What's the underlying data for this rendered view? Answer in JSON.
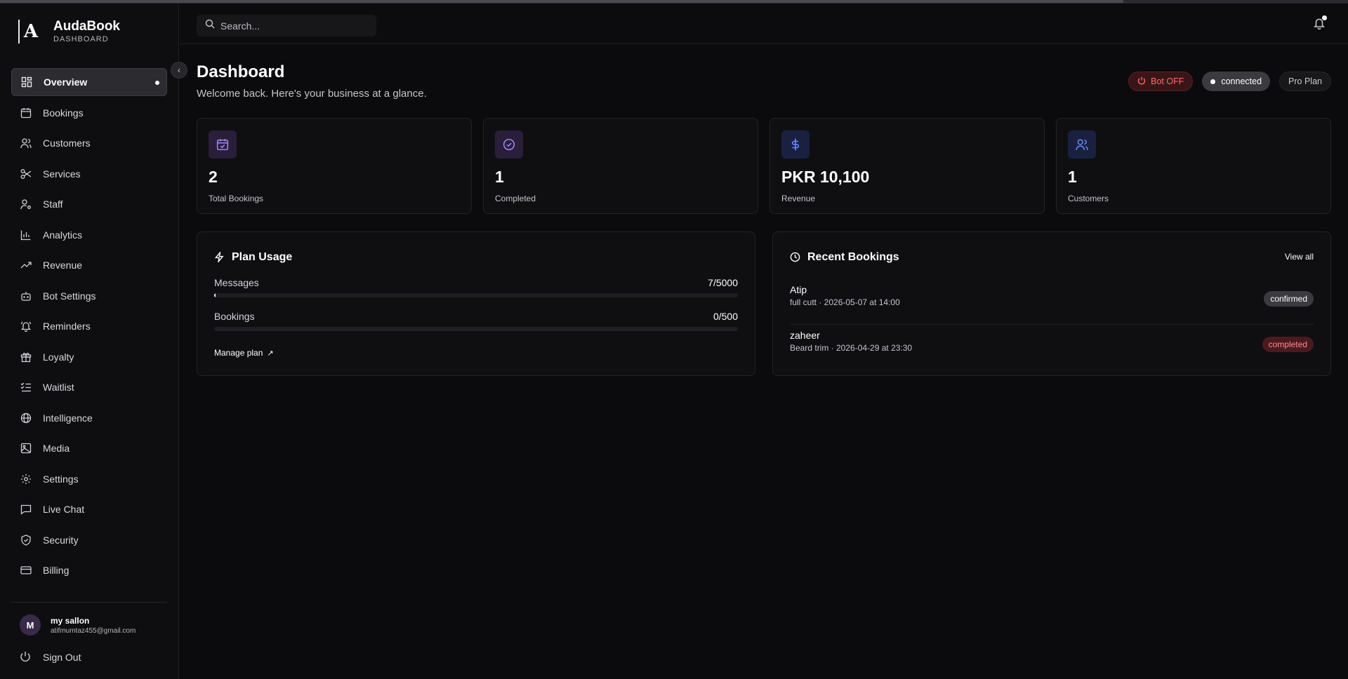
{
  "brand": {
    "name": "AudaBook",
    "sub": "DASHBOARD"
  },
  "sidebar": {
    "items": [
      {
        "label": "Overview",
        "icon": "grid-icon",
        "active": true
      },
      {
        "label": "Bookings",
        "icon": "calendar-icon"
      },
      {
        "label": "Customers",
        "icon": "users-icon"
      },
      {
        "label": "Services",
        "icon": "scissors-icon"
      },
      {
        "label": "Staff",
        "icon": "user-cog-icon"
      },
      {
        "label": "Analytics",
        "icon": "bar-chart-icon"
      },
      {
        "label": "Revenue",
        "icon": "trending-up-icon"
      },
      {
        "label": "Bot Settings",
        "icon": "bot-icon"
      },
      {
        "label": "Reminders",
        "icon": "bell-ring-icon"
      },
      {
        "label": "Loyalty",
        "icon": "gift-icon"
      },
      {
        "label": "Waitlist",
        "icon": "list-checks-icon"
      },
      {
        "label": "Intelligence",
        "icon": "globe-icon"
      },
      {
        "label": "Media",
        "icon": "image-icon"
      },
      {
        "label": "Settings",
        "icon": "gear-icon"
      },
      {
        "label": "Live Chat",
        "icon": "chat-icon"
      },
      {
        "label": "Security",
        "icon": "shield-icon"
      },
      {
        "label": "Billing",
        "icon": "credit-card-icon"
      }
    ],
    "user": {
      "initial": "M",
      "name": "my sallon",
      "email": "atifmumtaz455@gmail.com"
    },
    "signout": "Sign Out"
  },
  "header": {
    "search_placeholder": "Search..."
  },
  "page": {
    "title": "Dashboard",
    "subtitle": "Welcome back. Here's your business at a glance.",
    "badges": {
      "bot": "Bot OFF",
      "connection": "connected",
      "plan": "Pro Plan"
    }
  },
  "stats": [
    {
      "value": "2",
      "label": "Total Bookings",
      "icon": "calendar-check-icon",
      "color": "#a78bfa"
    },
    {
      "value": "1",
      "label": "Completed",
      "icon": "check-circle-icon",
      "color": "#a78bfa"
    },
    {
      "value": "PKR 10,100",
      "label": "Revenue",
      "icon": "dollar-icon",
      "color": "#6b8cff"
    },
    {
      "value": "1",
      "label": "Customers",
      "icon": "users-icon",
      "color": "#6b8cff"
    }
  ],
  "plan_usage": {
    "title": "Plan Usage",
    "rows": [
      {
        "label": "Messages",
        "value": "7/5000",
        "fraction": 0.0014
      },
      {
        "label": "Bookings",
        "value": "0/500",
        "fraction": 0
      }
    ],
    "manage": "Manage plan"
  },
  "recent": {
    "title": "Recent Bookings",
    "view_all": "View all",
    "items": [
      {
        "name": "Atip",
        "meta": "full cutt · 2026-05-07 at 14:00",
        "status": "confirmed"
      },
      {
        "name": "zaheer",
        "meta": "Beard trim · 2026-04-29 at 23:30",
        "status": "completed"
      }
    ]
  }
}
